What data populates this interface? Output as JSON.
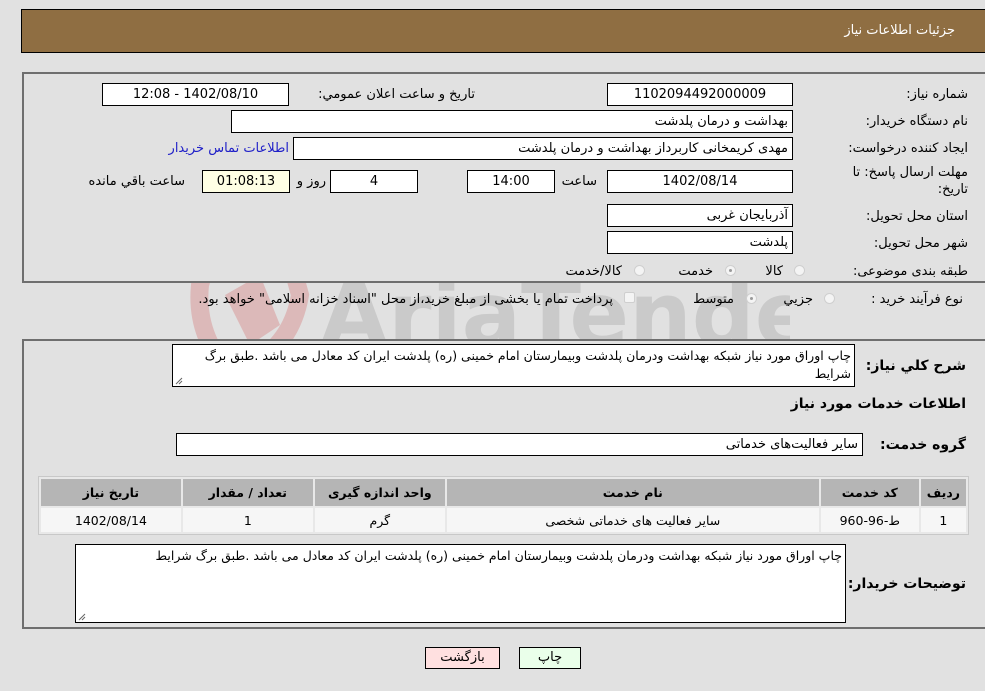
{
  "header": {
    "title": "جزئیات اطلاعات نیاز"
  },
  "form": {
    "need_number": {
      "label": "شماره نیاز:",
      "value": "1102094492000009"
    },
    "announce_datetime": {
      "label": "تاریخ و ساعت اعلان عمومي:",
      "value": "1402/08/10 - 12:08"
    },
    "buyer_org": {
      "label": "نام دستگاه خريدار:",
      "value": "بهداشت و درمان پلدشت"
    },
    "requester": {
      "label": "ايجاد كننده درخواست:",
      "value": "مهدی کریمخانی کاربرداز بهداشت و درمان پلدشت"
    },
    "buyer_contact_link": "اطلاعات تماس خريدار",
    "deadline": {
      "label_line1": "مهلت ارسال پاسخ: تا",
      "label_line2": "تاريخ:",
      "date": "1402/08/14",
      "time_label": "ساعت",
      "time": "14:00",
      "days": "4",
      "days_label": "روز و",
      "remaining": "01:08:13",
      "remaining_label": "ساعت باقي مانده"
    },
    "province": {
      "label": "استان محل تحويل:",
      "value": "آذربایجان غربی"
    },
    "city": {
      "label": "شهر محل تحويل:",
      "value": "پلدشت"
    },
    "category": {
      "label": "طبقه بندی موضوعی:",
      "options": [
        {
          "label": "کالا",
          "checked": false
        },
        {
          "label": "خدمت",
          "checked": true
        },
        {
          "label": "کالا/خدمت",
          "checked": false
        }
      ]
    },
    "purchase_type": {
      "label": "نوع فرآيند خريد :",
      "options": [
        {
          "label": "جزيي",
          "checked": false
        },
        {
          "label": "متوسط",
          "checked": true
        }
      ],
      "treasury_checkbox_label": "پرداخت تمام يا بخشی از مبلغ خريد،از محل \"اسناد خزانه اسلامی\" خواهد بود.",
      "treasury_checked": false
    }
  },
  "details": {
    "summary_label": "شرح كلي نياز:",
    "summary_text": "چاپ اوراق مورد نیاز شبکه بهداشت ودرمان  پلدشت وبیمارستان امام خمینی (ره) پلدشت ایران کد معادل می باشد .طبق برگ شرایط",
    "services_heading": "اطلاعات خدمات مورد نياز",
    "service_group_label": "گروه خدمت:",
    "service_group_value": "سایر فعالیت‌های خدماتی",
    "table": {
      "headers": [
        "رديف",
        "كد خدمت",
        "نام خدمت",
        "واحد اندازه گيری",
        "تعداد / مقدار",
        "تاريخ نياز"
      ],
      "rows": [
        [
          "1",
          "ط-96-960",
          "سایر فعالیت های خدماتی شخصی",
          "گرم",
          "1",
          "1402/08/14"
        ]
      ]
    },
    "buyer_notes_label": "توضيحات خريدار:",
    "buyer_notes_text": "چاپ اوراق مورد نیاز شبکه بهداشت ودرمان  پلدشت وبیمارستان امام خمینی (ره) پلدشت ایران کد معادل می باشد .طبق برگ شرایط"
  },
  "buttons": {
    "print": "چاپ",
    "back": "بازگشت"
  },
  "colors": {
    "header_bg": "#8f6e42",
    "print_bg": "#eaffea",
    "back_bg": "#ffe0e0",
    "link": "#2020c8"
  }
}
